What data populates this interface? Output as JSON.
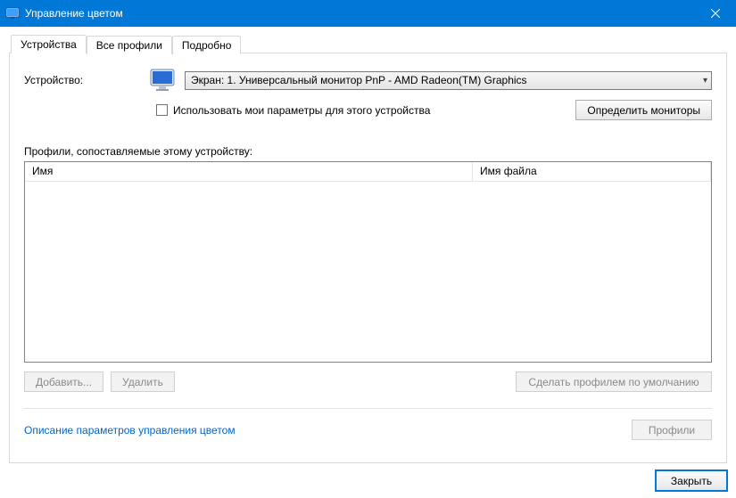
{
  "window": {
    "title": "Управление цветом"
  },
  "tabs": {
    "devices": "Устройства",
    "all_profiles": "Все профили",
    "advanced": "Подробно"
  },
  "panel": {
    "device_label": "Устройство:",
    "device_value": "Экран: 1. Универсальный монитор PnP - AMD Radeon(TM) Graphics",
    "use_my_settings": "Использовать мои параметры для этого устройства",
    "identify_monitors": "Определить мониторы",
    "profiles_for_device": "Профили, сопоставляемые этому устройству:",
    "columns": {
      "name": "Имя",
      "file": "Имя файла"
    },
    "buttons": {
      "add": "Добавить...",
      "remove": "Удалить",
      "set_default": "Сделать профилем по умолчанию"
    },
    "link": "Описание параметров управления цветом",
    "profiles_btn": "Профили"
  },
  "footer": {
    "close": "Закрыть"
  }
}
